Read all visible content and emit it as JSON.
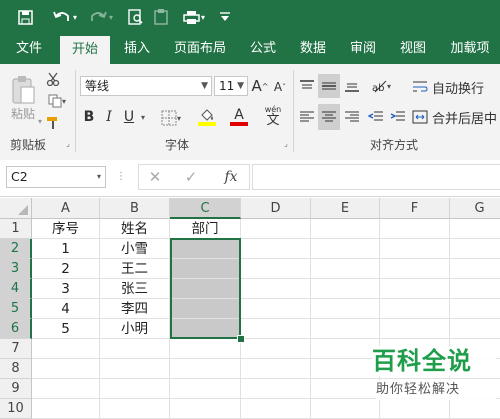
{
  "tabs": [
    "文件",
    "开始",
    "插入",
    "页面布局",
    "公式",
    "数据",
    "审阅",
    "视图",
    "加载项"
  ],
  "active_tab": "开始",
  "clipboard": {
    "paste_label": "粘贴",
    "group_label": "剪贴板"
  },
  "font": {
    "name": "等线",
    "size": "11",
    "group_label": "字体",
    "bold": "B",
    "italic": "I",
    "underline": "U",
    "grow": "A",
    "shrink": "A",
    "wen": "wén",
    "wen_char": "文"
  },
  "alignment": {
    "wrap_label": "自动换行",
    "merge_label": "合并后居中",
    "group_label": "对齐方式"
  },
  "namebox": {
    "value": "C2"
  },
  "formula_bar": {
    "fx": "fx",
    "value": ""
  },
  "columns": [
    "A",
    "B",
    "C",
    "D",
    "E",
    "F",
    "G"
  ],
  "rows": [
    "1",
    "2",
    "3",
    "4",
    "5",
    "6",
    "7",
    "8",
    "9",
    "10"
  ],
  "cells": {
    "A1": "序号",
    "B1": "姓名",
    "C1": "部门",
    "A2": "1",
    "B2": "小雪",
    "A3": "2",
    "B3": "王二",
    "A4": "3",
    "B4": "张三",
    "A5": "4",
    "B5": "李四",
    "A6": "5",
    "B6": "小明"
  },
  "watermark": {
    "title": "百科全说",
    "subtitle": "助你轻松解决"
  },
  "colors": {
    "excel_green": "#217346",
    "fill_yellow": "#ffff00",
    "font_red": "#e00000",
    "selection_gray": "#c9c9c9"
  }
}
